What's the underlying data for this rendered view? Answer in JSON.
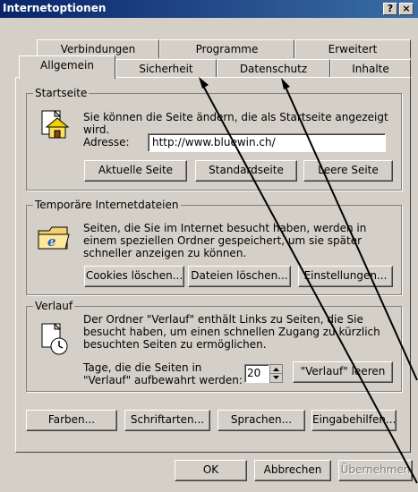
{
  "window": {
    "title": "Internetoptionen",
    "help_glyph": "?",
    "close_glyph": "×"
  },
  "tabs_back": [
    "Verbindungen",
    "Programme",
    "Erweitert"
  ],
  "tabs_front": [
    "Allgemein",
    "Sicherheit",
    "Datenschutz",
    "Inhalte"
  ],
  "active_tab": "Allgemein",
  "startseite": {
    "legend": "Startseite",
    "description": "Sie können die Seite ändern, die als Startseite angezeigt wird.",
    "address_label": "Adresse:",
    "address_value": "http://www.bluewin.ch/",
    "btn_current": "Aktuelle Seite",
    "btn_standard": "Standardseite",
    "btn_empty": "Leere Seite",
    "icon": "home-page-icon"
  },
  "temp_files": {
    "legend": "Temporäre Internetdateien",
    "description": "Seiten, die Sie im Internet besucht haben, werden in einem speziellen Ordner gespeichert, um sie später schneller anzeigen zu können.",
    "btn_cookies": "Cookies löschen...",
    "btn_files": "Dateien löschen...",
    "btn_settings": "Einstellungen...",
    "icon": "ie-folder-icon"
  },
  "history": {
    "legend": "Verlauf",
    "description": "Der Ordner \"Verlauf\" enthält Links zu Seiten, die Sie besucht haben, um einen schnellen Zugang zu kürzlich besuchten Seiten zu ermöglichen.",
    "days_label": "Tage, die die Seiten in \"Verlauf\" aufbewahrt werden:",
    "days_value": "20",
    "btn_clear": "\"Verlauf\" leeren",
    "icon": "history-clock-icon"
  },
  "bottom_buttons": {
    "colors": "Farben...",
    "fonts": "Schriftarten...",
    "languages": "Sprachen...",
    "accessibility": "Eingabehilfen..."
  },
  "dialog_buttons": {
    "ok": "OK",
    "cancel": "Abbrechen",
    "apply": "Übernehmen"
  },
  "colors": {
    "titlebar_start": "#0a246a",
    "titlebar_end": "#3a6ea5",
    "face": "#d4d0c8",
    "annotation_arrows": "#000000"
  }
}
